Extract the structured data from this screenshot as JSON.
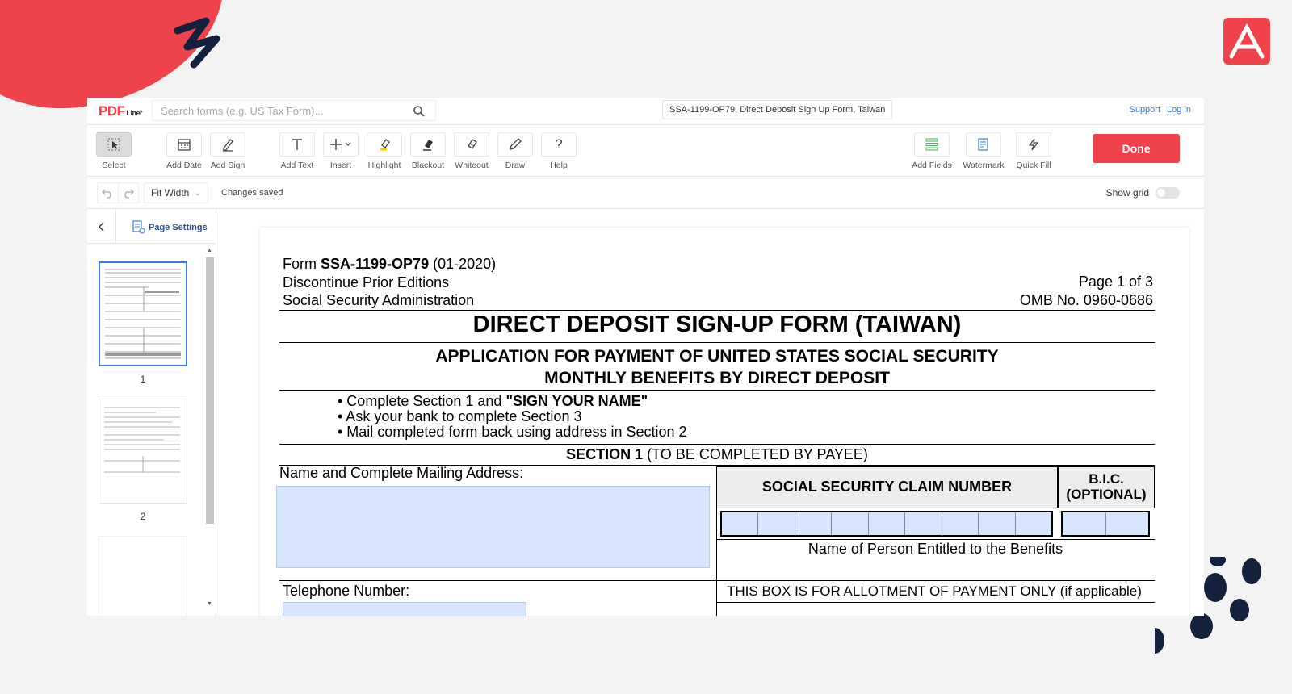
{
  "brand": {
    "name": "PDF",
    "suffix": "Liner",
    "accent": "#f0424a"
  },
  "search": {
    "placeholder": "Search forms (e.g. US Tax Form)..."
  },
  "document_title": "SSA-1199-OP79, Direct Deposit Sign Up Form, Taiwan",
  "top_links": {
    "support": "Support",
    "login": "Log in"
  },
  "toolbar": {
    "tools": [
      "Select",
      "Add Date",
      "Add Sign",
      "Add Text",
      "Insert",
      "Highlight",
      "Blackout",
      "Whiteout",
      "Draw",
      "Help"
    ],
    "right_tools": [
      "Add Fields",
      "Watermark",
      "Quick Fill"
    ],
    "done": "Done"
  },
  "subbar": {
    "zoom": "Fit Width",
    "status": "Changes saved",
    "show_grid": "Show grid"
  },
  "sidebar": {
    "page_settings": "Page Settings",
    "pages": [
      "1",
      "2"
    ]
  },
  "form": {
    "form_prefix": "Form ",
    "form_number": "SSA-1199-OP79",
    "form_date": " (01-2020)",
    "line2": "Discontinue Prior Editions",
    "line3": "Social Security Administration",
    "page": "Page 1 of 3",
    "omb": "OMB No. 0960-0686",
    "title": "DIRECT DEPOSIT SIGN-UP FORM (TAIWAN)",
    "subtitle_line1": "APPLICATION FOR PAYMENT OF UNITED STATES SOCIAL SECURITY",
    "subtitle_line2": "MONTHLY BENEFITS BY DIRECT DEPOSIT",
    "bullet1_a": "• Complete Section 1 and ",
    "bullet1_b": "\"SIGN YOUR NAME\"",
    "bullet2": "• Ask your bank to complete Section 3",
    "bullet3": "• Mail completed form back using address in Section 2",
    "section_bold": "SECTION 1",
    "section_rest": " (TO BE COMPLETED BY PAYEE)",
    "name_label": "Name and Complete Mailing Address:",
    "ssn_header": "SOCIAL SECURITY CLAIM NUMBER",
    "bic_line1": "B.I.C.",
    "bic_line2": "(OPTIONAL)",
    "entitled": "Name of Person Entitled to the Benefits",
    "telephone": "Telephone Number:",
    "allotment": "THIS BOX IS FOR ALLOTMENT OF PAYMENT ONLY (if applicable)"
  }
}
